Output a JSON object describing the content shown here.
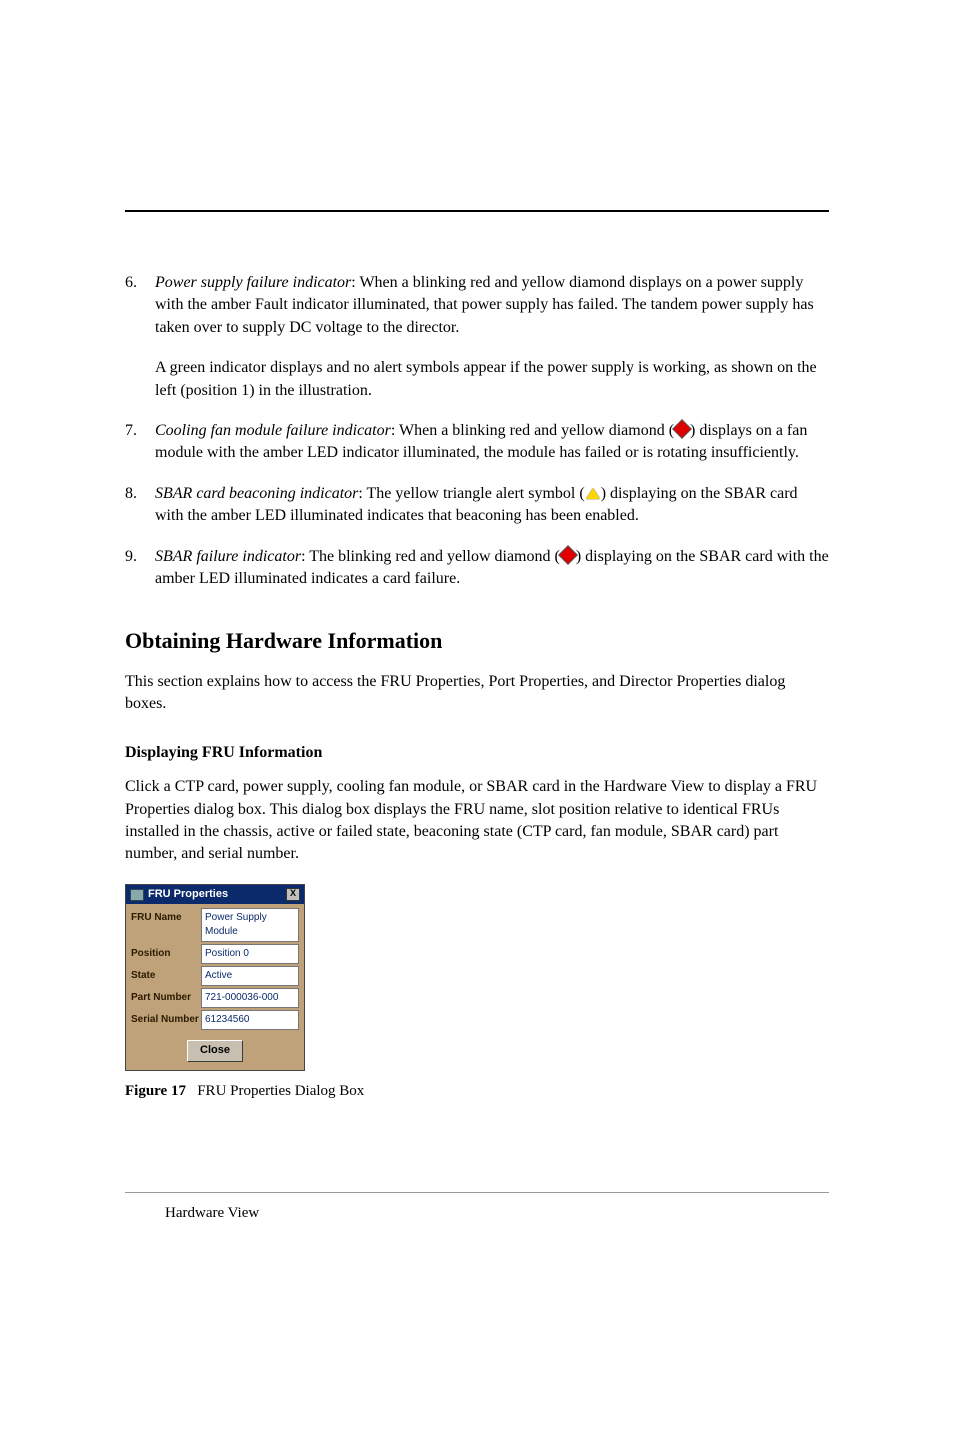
{
  "items": [
    {
      "num": "6.",
      "term": "Power supply failure indicator",
      "text1": ": When a blinking red and yellow diamond displays on a power supply with the amber Fault indicator illuminated, that power supply has failed. The tandem power supply has taken over to supply DC voltage to the director.",
      "text2": "A green indicator displays and no alert symbols appear if the power supply is working, as shown on the left (position 1) in the illustration."
    },
    {
      "num": "7.",
      "term": "Cooling fan module failure indicator",
      "pre": ": When a blinking red and yellow diamond (",
      "icon": "diamond",
      "post": ") displays on a fan module with the amber LED indicator illuminated, the module has failed or is rotating insufficiently."
    },
    {
      "num": "8.",
      "term": "SBAR card beaconing indicator",
      "pre": ": The yellow triangle alert symbol (",
      "icon": "triangle",
      "post": ") displaying on the SBAR card with the amber LED illuminated indicates that beaconing has been enabled."
    },
    {
      "num": "9.",
      "term": "SBAR failure indicator",
      "pre": ": The blinking red and yellow diamond (",
      "icon": "diamond",
      "post": ") displaying on the SBAR card with the amber LED illuminated indicates a card failure."
    }
  ],
  "heading": "Obtaining Hardware Information",
  "intro": "This section explains how to access the FRU Properties, Port Properties, and Director Properties dialog boxes.",
  "sub": "Displaying FRU Information",
  "sub_text": "Click a CTP card, power supply, cooling fan module, or SBAR card in the Hardware View to display a FRU Properties dialog box. This dialog box displays the FRU name, slot position relative to identical FRUs installed in the chassis, active or failed state, beaconing state (CTP card, fan module, SBAR card) part number, and serial number.",
  "dialog": {
    "title": "FRU Properties",
    "close": "X",
    "rows": [
      {
        "label": "FRU Name",
        "value": "Power Supply Module"
      },
      {
        "label": "Position",
        "value": "Position 0"
      },
      {
        "label": "State",
        "value": "Active"
      },
      {
        "label": "Part Number",
        "value": "721-000036-000"
      },
      {
        "label": "Serial Number",
        "value": "61234560"
      }
    ],
    "button": "Close"
  },
  "caption_num": "Figure 17",
  "caption_text": "FRU Properties Dialog Box",
  "footer": "Hardware View"
}
